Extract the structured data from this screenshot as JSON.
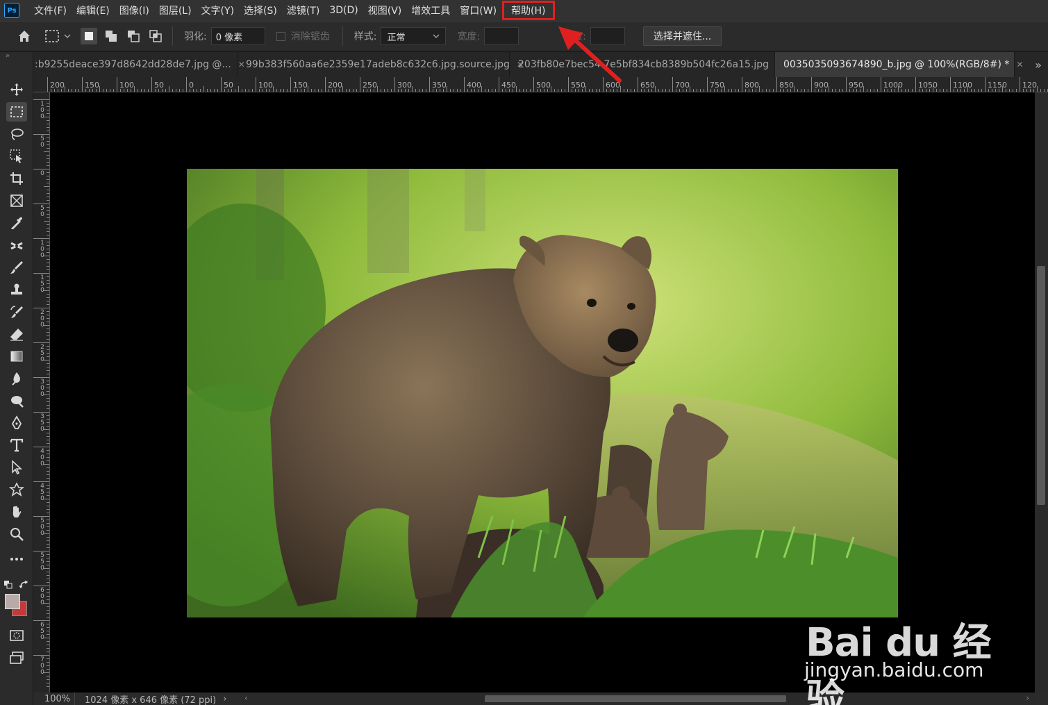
{
  "app": {
    "logo": "Ps",
    "menus": [
      "文件(F)",
      "编辑(E)",
      "图像(I)",
      "图层(L)",
      "文字(Y)",
      "选择(S)",
      "滤镜(T)",
      "3D(D)",
      "视图(V)",
      "增效工具",
      "窗口(W)",
      "帮助(H)"
    ],
    "highlighted_menu": "帮助(H)",
    "annotation_color": "#e02020"
  },
  "options": {
    "feather_label": "羽化:",
    "feather_value": "0 像素",
    "antialias_label": "消除锯齿",
    "style_label": "样式:",
    "style_value": "正常",
    "width_label": "宽度:",
    "height_label": "高度:",
    "select_mask_button": "选择并遮住..."
  },
  "tabs": [
    {
      "label": ":b9255deace397d8642dd28de7.jpg @...",
      "active": false
    },
    {
      "label": "99b383f560aa6e2359e17adeb8c632c6.jpg.source.jpg",
      "active": false
    },
    {
      "label": "203fb80e7bec54 7e5bf834cb8389b504fc26a15.jpg",
      "active": false
    },
    {
      "label": "0035035093674890_b.jpg @ 100%(RGB/8#) *",
      "active": true
    }
  ],
  "ruler": {
    "h_labels": [
      "200",
      "150",
      "100",
      "50",
      "0",
      "50",
      "100",
      "150",
      "200",
      "250",
      "300",
      "350",
      "400",
      "450",
      "500",
      "550",
      "600",
      "650",
      "700",
      "750",
      "800",
      "850",
      "900",
      "950",
      "1000",
      "1050",
      "1100",
      "1150",
      "120"
    ],
    "v_labels": [
      "100",
      "50",
      "0",
      "50",
      "100",
      "150",
      "200",
      "250",
      "300",
      "350",
      "400",
      "450",
      "500",
      "550",
      "600",
      "650",
      "700"
    ]
  },
  "status": {
    "zoom": "100%",
    "info": "1024 像素 x 646 像素 (72 ppi)",
    "arrow": "›"
  },
  "watermark": {
    "line1": "Bai du 经验",
    "line2": "jingyan.baidu.com"
  },
  "tools": [
    "move-tool",
    "marquee-tool",
    "lasso-tool",
    "object-select-tool",
    "crop-tool",
    "frame-tool",
    "eyedropper-tool",
    "healing-tool",
    "brush-tool",
    "stamp-tool",
    "history-brush-tool",
    "eraser-tool",
    "gradient-tool",
    "blur-tool",
    "dodge-tool",
    "pen-tool",
    "type-tool",
    "path-select-tool",
    "shape-tool",
    "hand-tool",
    "zoom-tool",
    "more-tools"
  ],
  "colors": {
    "foreground": "#b8aaa8",
    "background": "#c43a3a"
  }
}
